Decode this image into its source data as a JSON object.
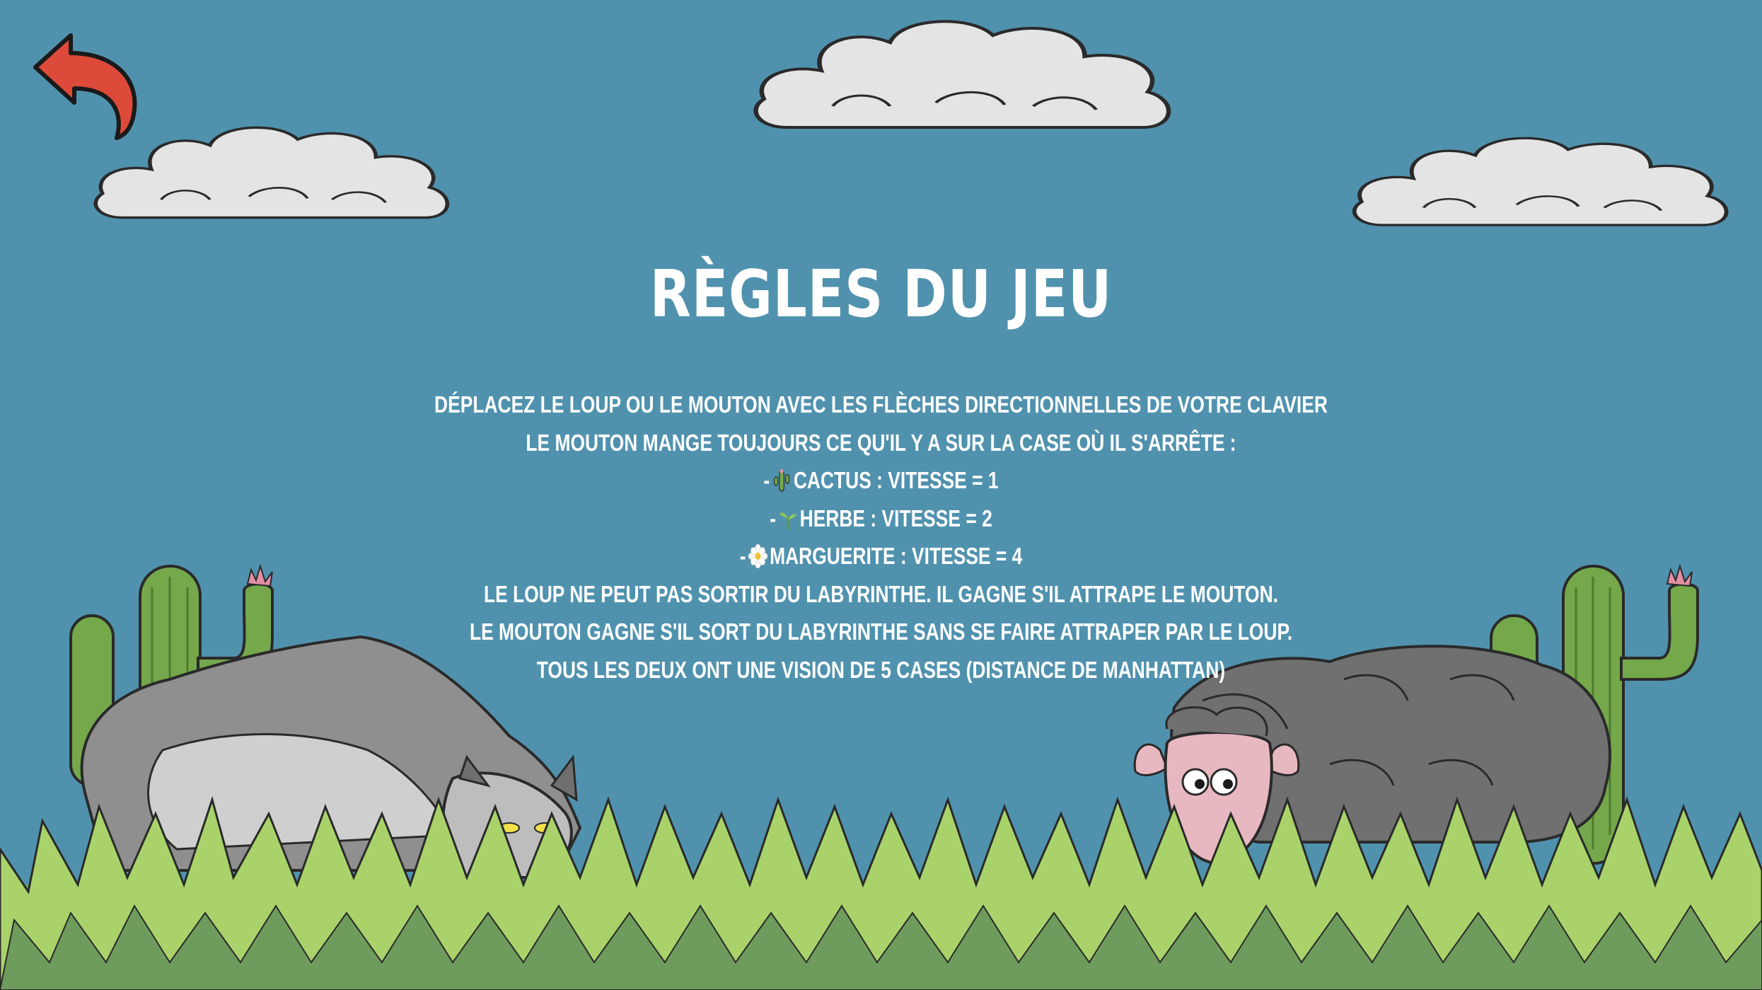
{
  "title": "RÈGLES DU JEU",
  "back_icon": "back-arrow-icon",
  "rules": {
    "line1": "DÉPLACEZ LE LOUP OU LE MOUTON AVEC LES FLÈCHES DIRECTIONNELLES DE VOTRE CLAVIER",
    "line2": "LE MOUTON MANGE TOUJOURS CE QU'IL Y A SUR LA CASE OÙ IL S'ARRÊTE :",
    "food": [
      {
        "prefix": "-",
        "icon": "cactus-icon",
        "text": "CACTUS : VITESSE = 1"
      },
      {
        "prefix": "-",
        "icon": "grass-sprout-icon",
        "text": "HERBE : VITESSE = 2"
      },
      {
        "prefix": "-",
        "icon": "daisy-icon",
        "text": "MARGUERITE : VITESSE = 4"
      }
    ],
    "line6": "LE LOUP NE PEUT PAS SORTIR DU LABYRINTHE. IL GAGNE S'IL ATTRAPE LE MOUTON.",
    "line7": "LE MOUTON GAGNE S'IL SORT DU LABYRINTHE SANS SE FAIRE ATTRAPER PAR LE LOUP.",
    "line8": "TOUS LES DEUX ONT UNE VISION DE 5 CASES (DISTANCE DE MANHATTAN)"
  },
  "colors": {
    "sky": "#5092ae",
    "text": "#ffffff",
    "back_arrow": "#dd4a3a",
    "cloud": "#e4e4e4",
    "cactus": "#74a84a",
    "grass_light": "#a9d36a",
    "grass_dark": "#6e9c5c"
  }
}
